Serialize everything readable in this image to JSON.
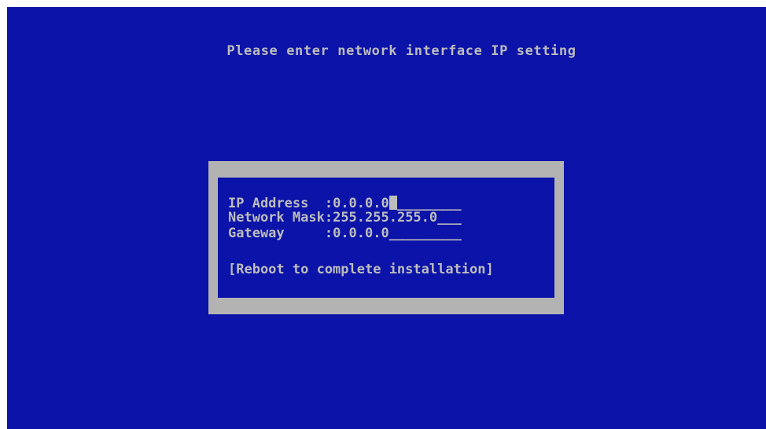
{
  "screen": {
    "heading": "Please enter network interface IP setting"
  },
  "dialog": {
    "fields": [
      {
        "label": "IP Address  ",
        "separator": ":",
        "value": "0.0.0.0",
        "fill": "________"
      },
      {
        "label": "Network Mask",
        "separator": ":",
        "value": "255.255.255.0",
        "fill": "___"
      },
      {
        "label": "Gateway     ",
        "separator": ":",
        "value": "0.0.0.0",
        "fill": "_________"
      }
    ],
    "action": "[Reboot to complete installation]"
  },
  "colors": {
    "background": "#0b13a8",
    "text": "#bdbdbd",
    "frame": "#b3b3b3"
  }
}
